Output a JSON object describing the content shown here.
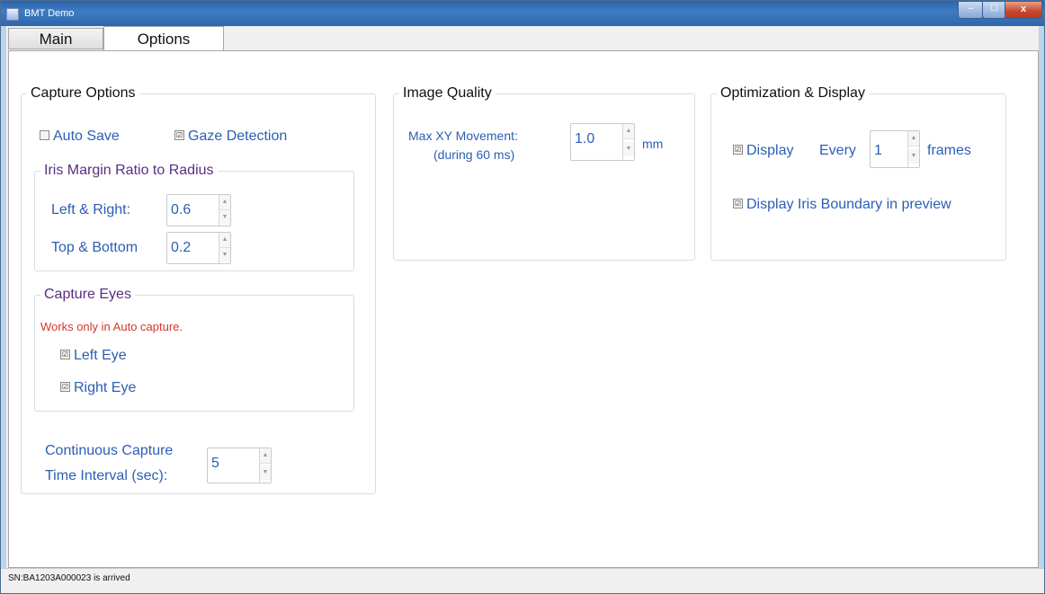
{
  "window": {
    "title": "BMT Demo",
    "controls": {
      "minimize": "‒",
      "maximize": "☐",
      "close": "x"
    }
  },
  "tabs": [
    "Main",
    "Options"
  ],
  "capture_options": {
    "legend": "Capture Options",
    "auto_save": {
      "label": "Auto Save",
      "checked": false
    },
    "gaze_detection": {
      "label": "Gaze Detection",
      "checked": true
    },
    "iris_margin": {
      "legend": "Iris Margin Ratio to Radius",
      "left_right_label": "Left & Right:",
      "left_right_value": "0.6",
      "top_bottom_label": "Top & Bottom",
      "top_bottom_value": "0.2"
    },
    "capture_eyes": {
      "legend": "Capture Eyes",
      "note": "Works only in Auto capture.",
      "left_eye": {
        "label": "Left Eye",
        "checked": true
      },
      "right_eye": {
        "label": "Right Eye",
        "checked": true
      }
    },
    "continuous": {
      "label_line1": "Continuous Capture",
      "label_line2": "Time Interval (sec):",
      "value": "5"
    }
  },
  "image_quality": {
    "legend": "Image Quality",
    "max_xy_label_line1": "Max XY Movement:",
    "max_xy_label_line2": "(during 60 ms)",
    "max_xy_value": "1.0",
    "unit": "mm"
  },
  "optimization": {
    "legend": "Optimization & Display",
    "display": {
      "label": "Display",
      "checked": true
    },
    "every_label": "Every",
    "every_value": "1",
    "frames_label": "frames",
    "iris_boundary": {
      "label": "Display Iris Boundary in preview",
      "checked": true
    }
  },
  "status_bar": {
    "text": "SN:BA1203A000023 is arrived"
  },
  "checkbox_mark": "☑"
}
